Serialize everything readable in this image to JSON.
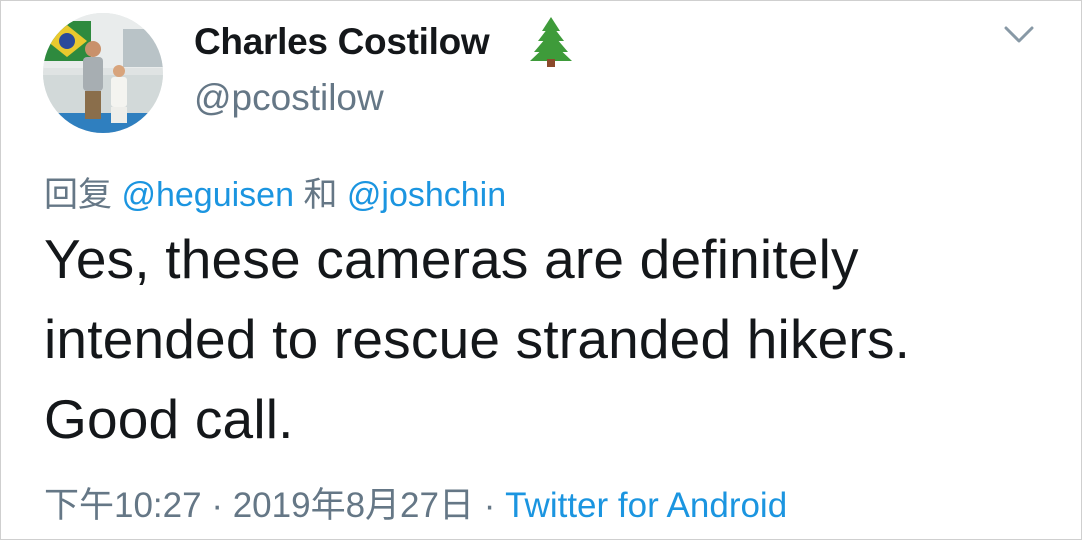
{
  "author": {
    "display_name": "Charles Costilow",
    "handle": "@pcostilow",
    "name_emoji_icon": "evergreen-tree-icon"
  },
  "reply": {
    "prefix": "回复",
    "mention_1": "@heguisen",
    "conjunction": "和",
    "mention_2": "@joshchin"
  },
  "tweet": {
    "text_line_1": "Yes, these cameras are definitely",
    "text_line_2": "intended to rescue stranded hikers.",
    "text_line_3": "Good call."
  },
  "meta": {
    "time": "下午10:27",
    "separator_1": "·",
    "date": "2019年8月27日",
    "separator_2": "·",
    "source": "Twitter for Android"
  },
  "colors": {
    "text": "#14171a",
    "secondary": "#657786",
    "link": "#1b95e0"
  },
  "icons": {
    "menu": "chevron-down-icon"
  }
}
